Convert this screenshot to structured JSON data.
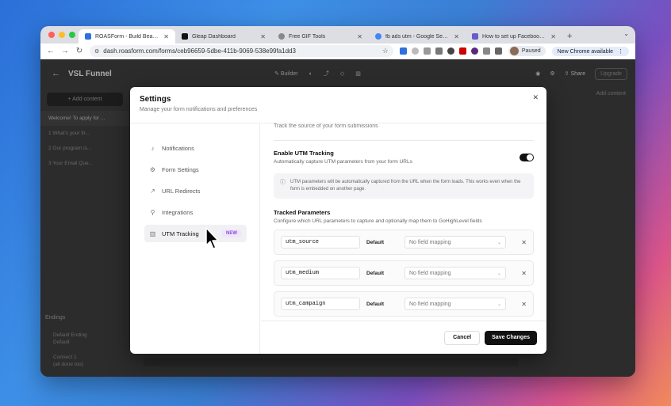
{
  "browser": {
    "tabs": [
      {
        "title": "ROASForm - Build Beautiful F",
        "color": "#2f6fe0",
        "active": true
      },
      {
        "title": "Gleap Dashboard",
        "color": "#111111",
        "active": false
      },
      {
        "title": "Free GIF Tools",
        "color": "#888888",
        "active": false
      },
      {
        "title": "fb ads utm - Google Search",
        "color": "#4285f4",
        "active": false
      },
      {
        "title": "How to set up Facebook Ad",
        "color": "#6a5acd",
        "active": false
      }
    ],
    "url": "dash.roasform.com/forms/ceb96659-5dbe-411b-9069-538e99fa1dd3",
    "profile_label": "Paused",
    "update_label": "New Chrome available"
  },
  "app": {
    "page_title": "VSL Funnel",
    "toolbar": {
      "builder": "Builder",
      "share": "Share",
      "upgrade": "Upgrade"
    },
    "add_content": "+ Add content",
    "questions": [
      "Welcome! To apply for ...",
      "1  What's your fir...",
      "2  Our program is...",
      "3  Your Email Que..."
    ],
    "endings_label": "Endings",
    "endings_items": [
      "Default Ending",
      "Default",
      "Connect 1",
      "(all done too)"
    ],
    "right_corner": "Add content"
  },
  "modal": {
    "title": "Settings",
    "subtitle": "Manage your form notifications and preferences",
    "nav": [
      {
        "label": "Notifications",
        "icon": "bell-icon"
      },
      {
        "label": "Form Settings",
        "icon": "gear-icon"
      },
      {
        "label": "URL Redirects",
        "icon": "external-link-icon"
      },
      {
        "label": "Integrations",
        "icon": "plug-icon"
      },
      {
        "label": "UTM Tracking",
        "icon": "chart-icon",
        "badge": "NEW",
        "active": true
      }
    ],
    "track_source": "Track the source of your form submissions",
    "enable_label": "Enable UTM Tracking",
    "enable_desc": "Automatically capture UTM parameters from your form URLs",
    "enabled": true,
    "info_text": "UTM parameters will be automatically captured from the URL when the form loads. This works even when the form is embedded on another page.",
    "tracked_title": "Tracked Parameters",
    "tracked_desc": "Configure which URL parameters to capture and optionally map them to GoHighLevel fields",
    "params": [
      {
        "name": "utm_source",
        "tag": "Default",
        "mapping": "No field mapping"
      },
      {
        "name": "utm_medium",
        "tag": "Default",
        "mapping": "No field mapping"
      },
      {
        "name": "utm_campaign",
        "tag": "Default",
        "mapping": "No field mapping"
      }
    ],
    "cancel_label": "Cancel",
    "save_label": "Save Changes"
  },
  "colors": {
    "accent": "#111111",
    "badge_bg": "#efe6fb",
    "badge_text": "#8a4bd6"
  }
}
